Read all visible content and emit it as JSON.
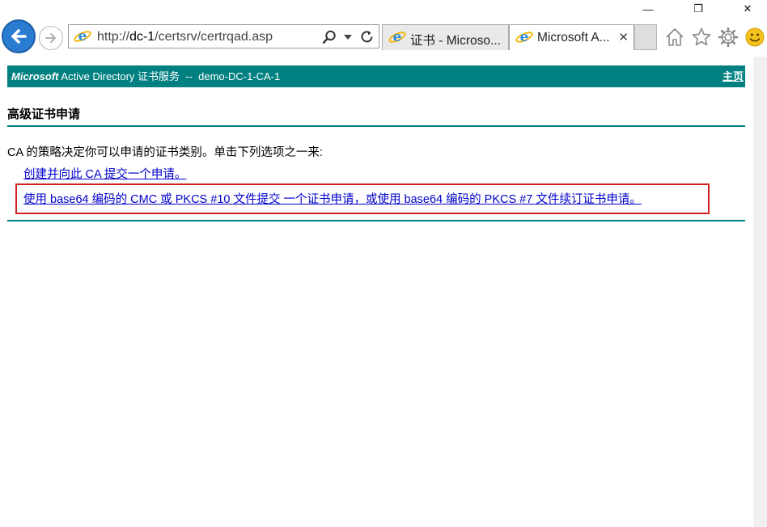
{
  "browser": {
    "address_url_prefix": "http://",
    "address_url_host": "dc-1",
    "address_url_path": "/certsrv/certrqad.asp",
    "tabs": [
      {
        "label": "证书 - Microso...",
        "active": false
      },
      {
        "label": "Microsoft A...",
        "active": true
      }
    ],
    "window_controls": {
      "minimize": "—",
      "restore": "❐",
      "close": "✕"
    },
    "icons": [
      "back-arrow-icon",
      "forward-arrow-icon",
      "ie-page-icon",
      "search-icon",
      "dropdown-icon",
      "refresh-icon",
      "home-icon",
      "favorites-star-icon",
      "settings-gear-icon",
      "smiley-feedback-icon"
    ]
  },
  "page": {
    "brand_ms": "Microsoft",
    "brand_rest": " Active Directory 证书服务  --  demo-DC-1-CA-1",
    "home_link": "主页",
    "section_title": "高级证书申请",
    "intro": "CA 的策略决定你可以申请的证书类别。单击下列选项之一来:",
    "link_create": "创建并向此 CA 提交一个申请。",
    "link_base64": "使用 base64 编码的 CMC 或 PKCS #10 文件提交 一个证书申请，或使用 base64 编码的 PKCS #7 文件续订证书申请。"
  },
  "colors": {
    "header_teal": "#008080",
    "link_blue": "#0000cc",
    "highlight_red": "#d42020"
  }
}
